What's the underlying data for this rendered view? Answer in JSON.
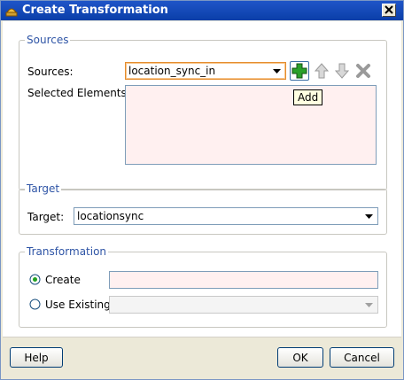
{
  "window": {
    "title": "Create Transformation"
  },
  "sources": {
    "legend": "Sources",
    "label": "Sources:",
    "value": "location_sync_in",
    "selected_label": "Selected Elements:",
    "tooltip": "Add"
  },
  "target": {
    "legend": "Target",
    "label": "Target:",
    "value": "locationsync"
  },
  "transformation": {
    "legend": "Transformation",
    "create_label": "Create",
    "use_existing_label": "Use Existing",
    "selected_option": "Create",
    "create_value": "",
    "use_existing_value": ""
  },
  "buttons": {
    "help": "Help",
    "ok": "OK",
    "cancel": "Cancel"
  },
  "icons": {
    "add": "plus-icon",
    "up": "arrow-up-icon",
    "down": "arrow-down-icon",
    "remove": "remove-icon"
  },
  "colors": {
    "titlebar": "#0a3ea8",
    "legend_text": "#2f55a6",
    "add_icon": "#2aa02a",
    "field_bg": "#fff0f0"
  }
}
